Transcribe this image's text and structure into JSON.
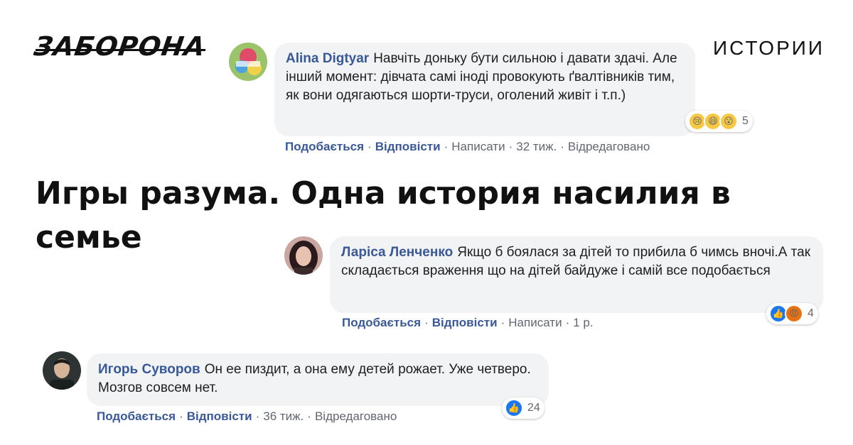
{
  "brand": {
    "logo_text": "ЗАБОРОНА",
    "section_label": "ИСТОРИИ"
  },
  "headline": "Игры разума. Одна история насилия в семье",
  "comments": [
    {
      "author": "Alina Digtyar",
      "text": "Навчіть доньку бути сильною і давати здачі. Але інший момент: дівчата самі іноді провокують ґвалтівників тим, як вони одягаються шорти-труси, оголений живіт і т.п.)",
      "reactions": {
        "icons": [
          "sad-icon",
          "laughing-icon",
          "wow-icon"
        ],
        "count": "5"
      },
      "actions": {
        "like": "Подобається",
        "reply": "Відповісти",
        "message": "Написати",
        "time": "32 тиж.",
        "edited": "Відредаговано"
      }
    },
    {
      "author": "Ларіса Ленченко",
      "text": "Якщо б боялася за дітей то прибила б чимсь вночі.А так складається враження що на дітей байдуже і самій все подобається",
      "reactions": {
        "icons": [
          "like-icon",
          "angry-icon"
        ],
        "count": "4"
      },
      "actions": {
        "like": "Подобається",
        "reply": "Відповісти",
        "message": "Написати",
        "time": "1 р."
      }
    },
    {
      "author": "Игорь Суворов",
      "text": "Он ее пиздит, а она ему детей рожает. Уже четверо. Мозгов совсем нет.",
      "reactions": {
        "icons": [
          "like-icon"
        ],
        "count": "24"
      },
      "actions": {
        "like": "Подобається",
        "reply": "Відповісти",
        "time": "36 тиж.",
        "edited": "Відредаговано"
      }
    }
  ],
  "colors": {
    "link": "#385898",
    "bubble": "#f2f3f5",
    "meta": "#616770",
    "like": "#1877f2"
  }
}
